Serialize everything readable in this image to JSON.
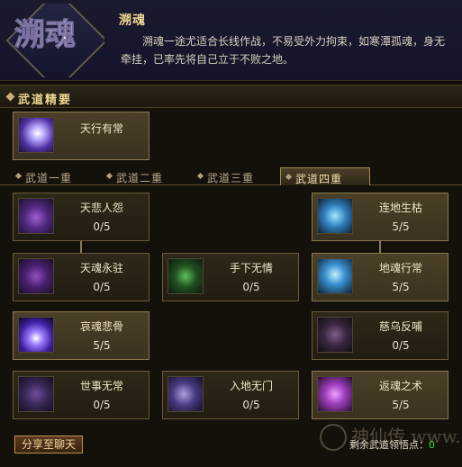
{
  "header": {
    "emblem_text": "溯魂",
    "title": "溯魂",
    "description": "溯魂一途尤适合长线作战，不易受外力拘束，如寒潭孤魂，身无牵挂，已率先将自己立于不败之地。"
  },
  "section": {
    "title": "武道精要"
  },
  "essence": {
    "name": "天行有常"
  },
  "tabs": [
    {
      "label": "武道一重",
      "active": false
    },
    {
      "label": "武道二重",
      "active": false
    },
    {
      "label": "武道三重",
      "active": false
    },
    {
      "label": "武道四重",
      "active": true
    }
  ],
  "skills": [
    {
      "name": "天悲人怨",
      "count": "0/5",
      "icon": "purple-spirit-icon",
      "lit": false
    },
    {
      "name": "天魂永驻",
      "count": "0/5",
      "icon": "purple-spirit-icon",
      "lit": false
    },
    {
      "name": "手下无情",
      "count": "0/5",
      "icon": "green-spirit-icon",
      "lit": false
    },
    {
      "name": "地魂行常",
      "count": "5/5",
      "icon": "blue-spirit-icon",
      "lit": true
    },
    {
      "name": "连地生枯",
      "count": "5/5",
      "icon": "blue-spirit-icon",
      "lit": true
    },
    {
      "name": "哀魂悲骨",
      "count": "5/5",
      "icon": "purple-flame-icon",
      "lit": true
    },
    {
      "name": "慈乌反哺",
      "count": "0/5",
      "icon": "purple-bird-icon",
      "lit": false
    },
    {
      "name": "世事无常",
      "count": "0/5",
      "icon": "purple-spirit-icon",
      "lit": false
    },
    {
      "name": "入地无门",
      "count": "0/5",
      "icon": "purple-wisp-icon",
      "lit": false
    },
    {
      "name": "返魂之术",
      "count": "5/5",
      "icon": "magenta-spirit-icon",
      "lit": true
    }
  ],
  "footer": {
    "share_label": "分享至聊天",
    "remaining_label": "剩余武道领悟点：",
    "remaining_value": "0",
    "watermark": "神仙传 www.sxds.com"
  },
  "colors": {
    "gold": "#f0d890",
    "green_value": "#30e030",
    "panel_dark": "#14110b"
  }
}
